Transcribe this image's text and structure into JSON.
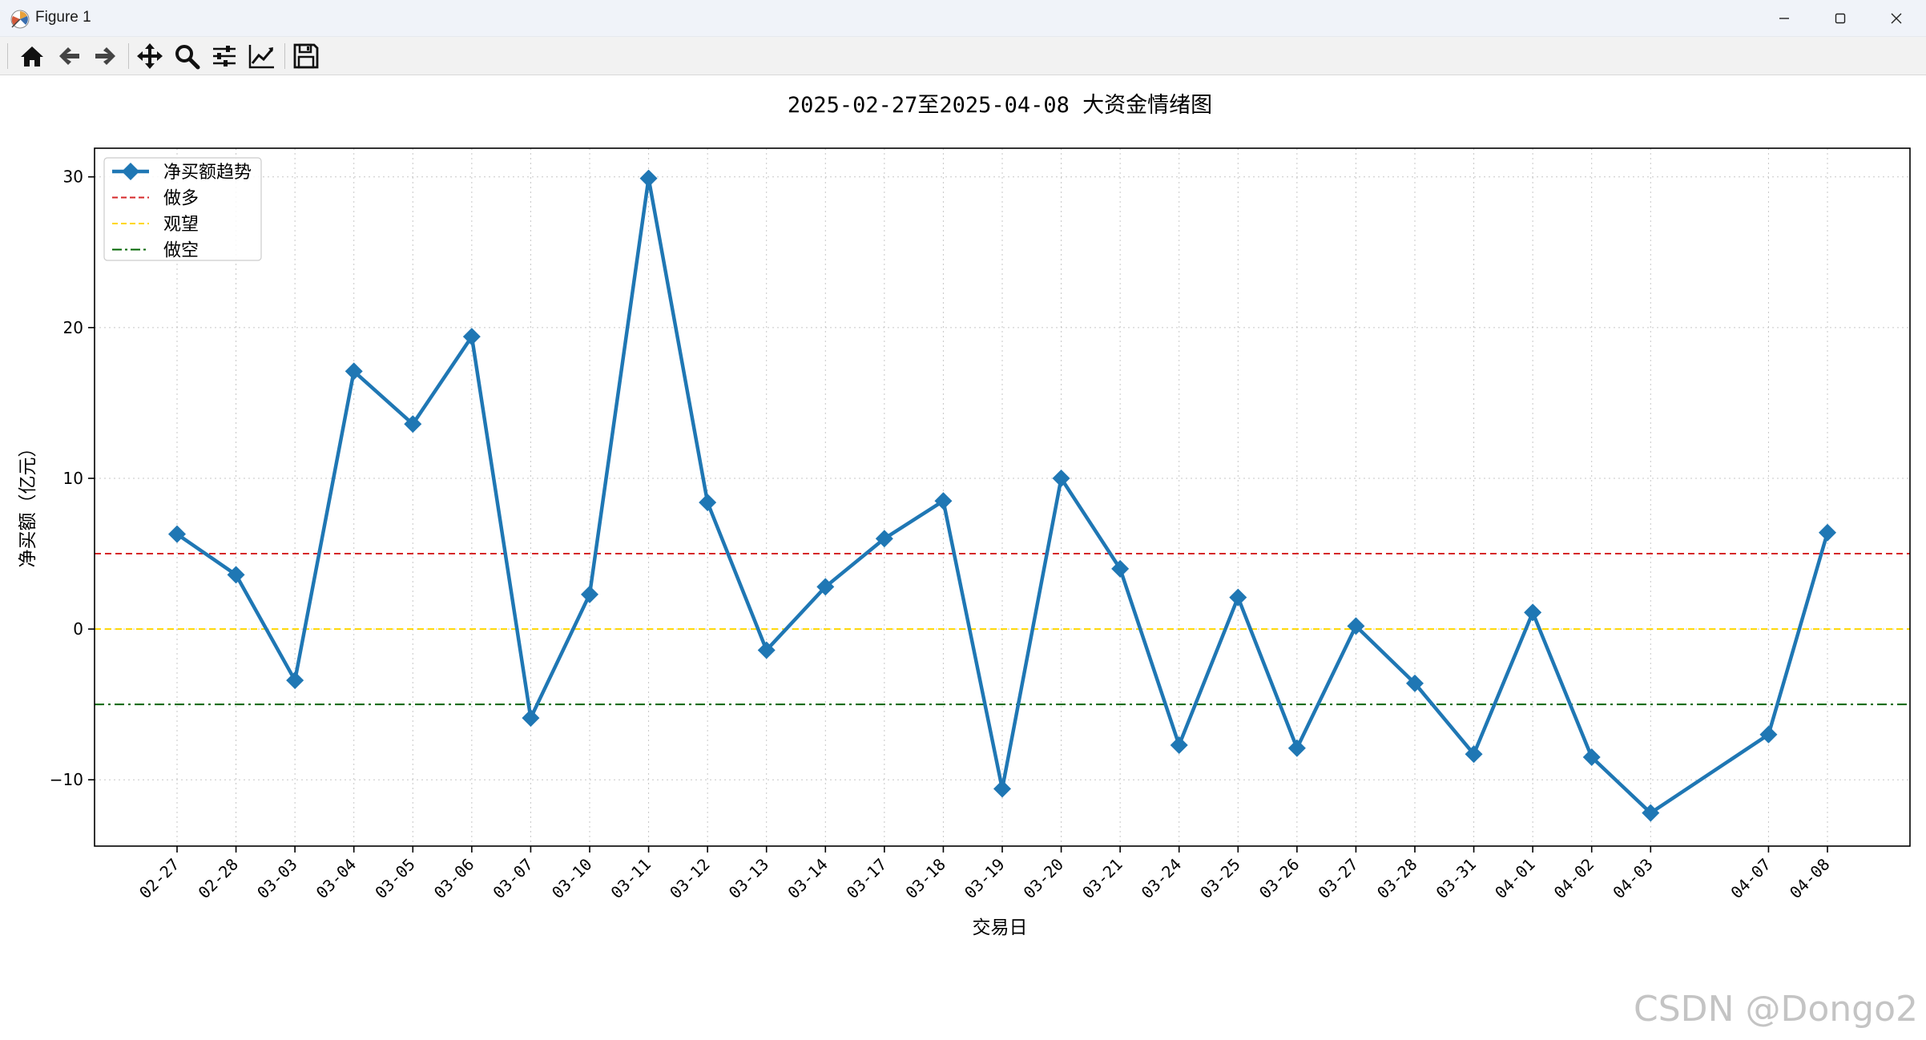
{
  "window": {
    "title": "Figure 1",
    "toolbar_icons": [
      "home-icon",
      "back-arrow-icon",
      "forward-arrow-icon",
      "pan-icon",
      "zoom-icon",
      "configure-subplots-icon",
      "edit-axes-icon",
      "save-icon"
    ]
  },
  "watermark": "CSDN @Dongo2",
  "colors": {
    "series": "#1f77b4",
    "bull_line": "#d62728",
    "neutral_line": "#ffd700",
    "bear_line": "#006400"
  },
  "chart_data": {
    "type": "line",
    "title": "2025-02-27至2025-04-08 大资金情绪图",
    "xlabel": "交易日",
    "ylabel": "净买额（亿元）",
    "x_axis": "trading_days",
    "categories": [
      "02-27",
      "02-28",
      "03-03",
      "03-04",
      "03-05",
      "03-06",
      "03-07",
      "03-10",
      "03-11",
      "03-12",
      "03-13",
      "03-14",
      "03-17",
      "03-18",
      "03-19",
      "03-20",
      "03-21",
      "03-24",
      "03-25",
      "03-26",
      "03-27",
      "03-28",
      "03-31",
      "04-01",
      "04-02",
      "04-03",
      "04-07",
      "04-08"
    ],
    "dates": [
      "2025-02-27",
      "2025-02-28",
      "2025-03-03",
      "2025-03-04",
      "2025-03-05",
      "2025-03-06",
      "2025-03-07",
      "2025-03-10",
      "2025-03-11",
      "2025-03-12",
      "2025-03-13",
      "2025-03-14",
      "2025-03-17",
      "2025-03-18",
      "2025-03-19",
      "2025-03-20",
      "2025-03-21",
      "2025-03-24",
      "2025-03-25",
      "2025-03-26",
      "2025-03-27",
      "2025-03-28",
      "2025-03-31",
      "2025-04-01",
      "2025-04-02",
      "2025-04-03",
      "2025-04-07",
      "2025-04-08"
    ],
    "series": [
      {
        "name": "净买额趋势",
        "marker": "diamond",
        "values": [
          6.3,
          3.6,
          -3.4,
          17.1,
          13.6,
          19.4,
          -5.9,
          2.3,
          29.9,
          8.4,
          -1.4,
          2.8,
          6.0,
          8.5,
          -10.6,
          10.0,
          4.0,
          -7.7,
          2.1,
          -7.9,
          0.2,
          -3.6,
          -8.3,
          1.1,
          -8.5,
          -12.2,
          -7.0,
          6.4
        ]
      }
    ],
    "reference_lines": [
      {
        "name": "做多",
        "y": 5,
        "style": "dashed",
        "color": "#d62728"
      },
      {
        "name": "观望",
        "y": 0,
        "style": "dashed",
        "color": "#ffd700"
      },
      {
        "name": "做空",
        "y": -5,
        "style": "dashdot",
        "color": "#006400"
      }
    ],
    "ylim": [
      -14.4,
      31.9
    ],
    "yticks": [
      -10,
      0,
      10,
      20,
      30
    ],
    "grid": true,
    "legend_position": "upper-left"
  }
}
